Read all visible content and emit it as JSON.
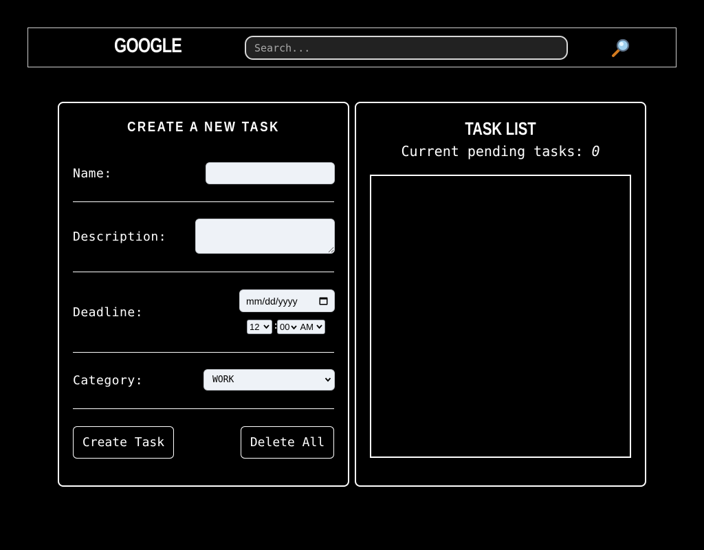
{
  "header": {
    "brand": "GOOGLE",
    "search_placeholder": "Search...",
    "search_icon": "magnifying-glass-icon"
  },
  "create_form": {
    "title": "CREATE A NEW TASK",
    "name_label": "Name:",
    "name_value": "",
    "description_label": "Description:",
    "description_value": "",
    "deadline_label": "Deadline:",
    "date_placeholder": "mm/dd/yyyy",
    "hour": "12",
    "time_separator": ":",
    "minute": "00",
    "meridiem": "AM",
    "category_label": "Category:",
    "category_value": "WORK",
    "create_button": "Create Task",
    "delete_button": "Delete All"
  },
  "task_list": {
    "title": "TASK LIST",
    "pending_label": "Current pending tasks: ",
    "pending_count": "0",
    "items": []
  },
  "colors": {
    "background": "#000000",
    "foreground": "#ffffff",
    "field_background": "#eef2f7",
    "search_background": "#222222"
  }
}
